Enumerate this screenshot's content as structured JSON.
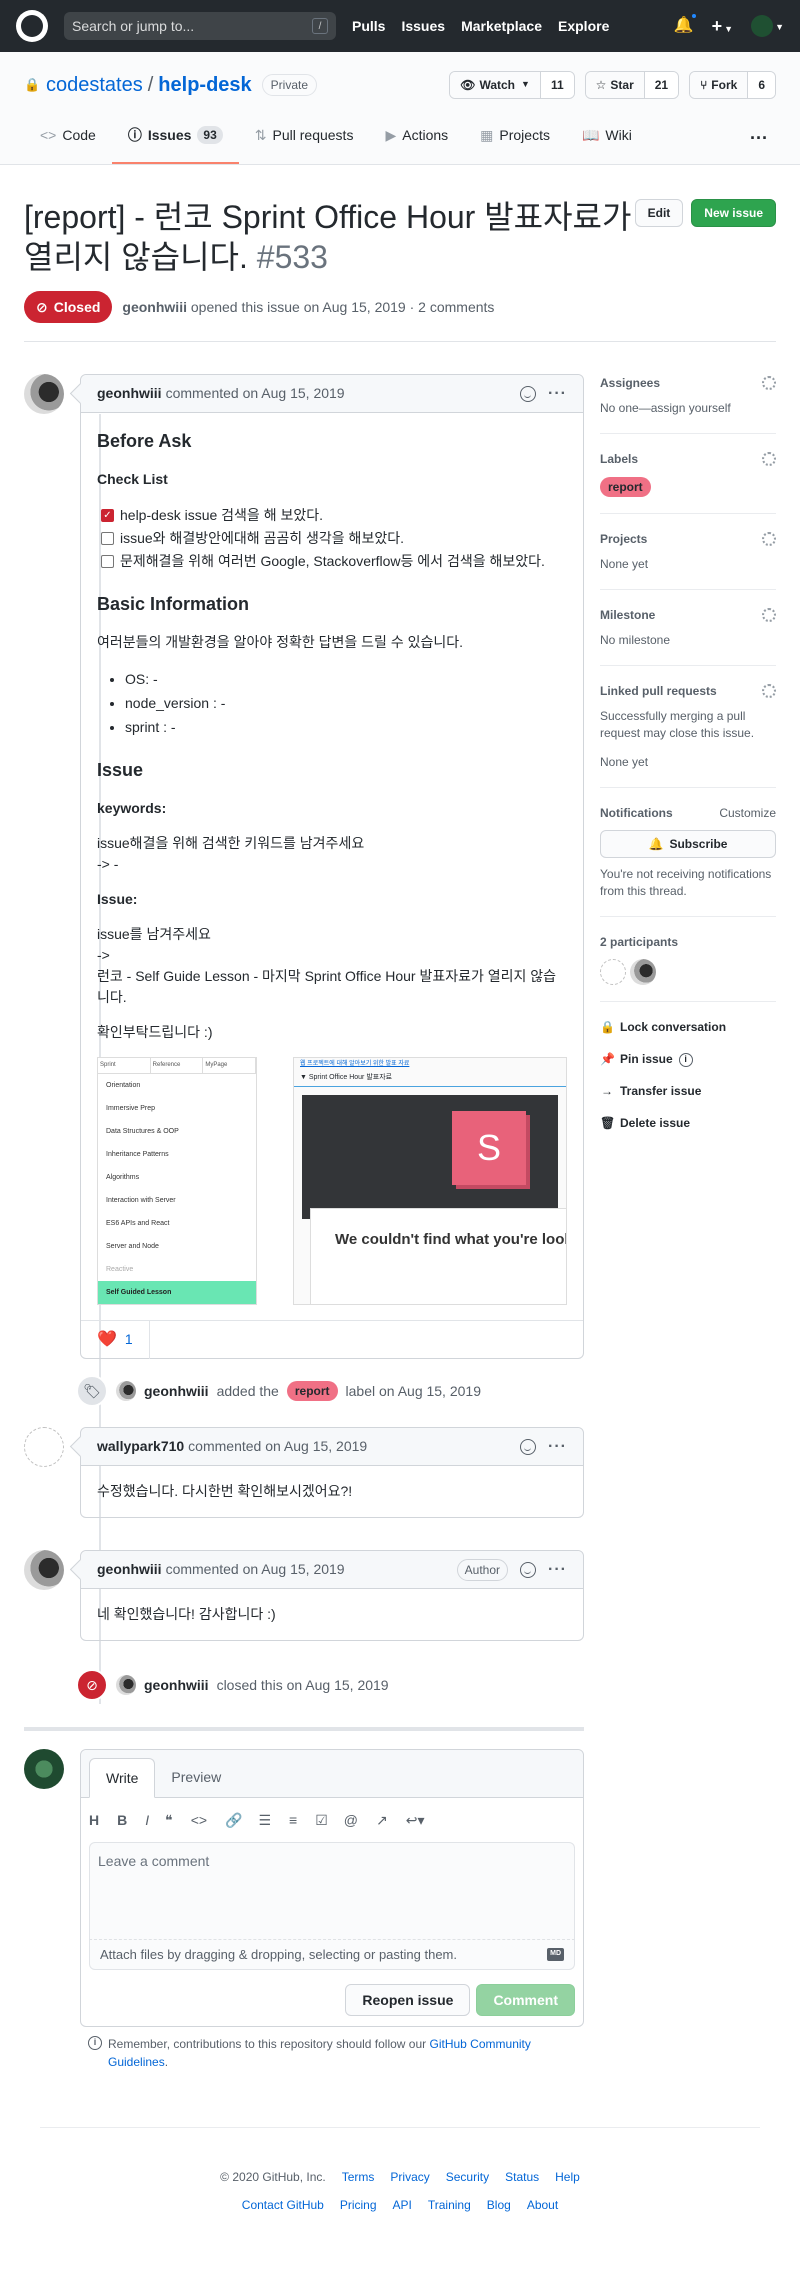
{
  "header": {
    "search_placeholder": "Search or jump to...",
    "search_hotkey": "/",
    "nav": [
      "Pulls",
      "Issues",
      "Marketplace",
      "Explore"
    ]
  },
  "repo": {
    "owner": "codestates",
    "separator": "/",
    "name": "help-desk",
    "visibility": "Private",
    "watch_label": "Watch",
    "watch_count": "11",
    "star_label": "Star",
    "star_count": "21",
    "fork_label": "Fork",
    "fork_count": "6",
    "tabs": [
      {
        "label": "Code",
        "icon": "code-icon"
      },
      {
        "label": "Issues",
        "icon": "issue-icon",
        "count": "93"
      },
      {
        "label": "Pull requests",
        "icon": "pull-request-icon"
      },
      {
        "label": "Actions",
        "icon": "play-icon"
      },
      {
        "label": "Projects",
        "icon": "project-icon"
      },
      {
        "label": "Wiki",
        "icon": "book-icon"
      }
    ]
  },
  "issue": {
    "title": "[report] - 런코 Sprint Office Hour 발표자료가 열리지 않습니다.",
    "number": "#533",
    "edit_label": "Edit",
    "new_issue_label": "New issue",
    "state": "Closed",
    "author": "geonhwiii",
    "meta_text": "opened this issue on Aug 15, 2019 · 2 comments"
  },
  "first_comment": {
    "author": "geonhwiii",
    "meta": "commented on Aug 15, 2019",
    "h_before_ask": "Before Ask",
    "h_check_list": "Check List",
    "checklist": [
      {
        "text": "help-desk issue 검색을 해 보았다.",
        "checked": true
      },
      {
        "text": "issue와 해결방안에대해 곰곰히 생각을 해보았다.",
        "checked": false
      },
      {
        "text": "문제해결을 위해 여러번 Google, Stackoverflow등 에서 검색을 해보았다.",
        "checked": false
      }
    ],
    "h_basic_info": "Basic Information",
    "basic_info_text": "여러분들의 개발환경을 알아야 정확한 답변을 드릴 수 있습니다.",
    "env": [
      "OS: -",
      "node_version : -",
      "sprint : -"
    ],
    "h_issue": "Issue",
    "h_keywords": "keywords:",
    "keywords_line1": "issue해결을 위해 검색한 키워드를 남겨주세요",
    "keywords_line2": "-> -",
    "h_issue_sub": "Issue:",
    "issue_line1": "issue를 남겨주세요",
    "issue_line2": "->",
    "issue_line3": "런코 - Self Guide Lesson - 마지막 Sprint Office Hour 발표자료가 열리지 않습니다.",
    "closing": "확인부탁드립니다 :)",
    "screenshot": {
      "tabs": [
        "Sprint",
        "Reference",
        "MyPage"
      ],
      "menu": [
        "Orientation",
        "Immersive Prep",
        "Data Structures & OOP",
        "Inheritance Patterns",
        "Algorithms",
        "Interaction with Server",
        "ES6 APIs and React",
        "Server and Node",
        "Reactive",
        "Self Guided Lesson"
      ],
      "top_link": "웹 프로젝트에 대해 알아보기 위한 발표 자료",
      "bar_text": "▼ Sprint Office Hour 발표자료",
      "logo_letter": "S",
      "error_text": "We couldn't find what you're look"
    },
    "reaction_count": "1"
  },
  "label_event": {
    "actor": "geonhwiii",
    "text_before": "added the",
    "label": "report",
    "text_after": "label on Aug 15, 2019"
  },
  "comment2": {
    "author": "wallypark710",
    "meta": "commented on Aug 15, 2019",
    "body": "수정했습니다. 다시한번 확인해보시겠어요?!"
  },
  "comment3": {
    "author": "geonhwiii",
    "meta": "commented on Aug 15, 2019",
    "badge": "Author",
    "body": "네 확인했습니다! 감사합니다 :)"
  },
  "close_event": {
    "actor": "geonhwiii",
    "text": "closed this on Aug 15, 2019"
  },
  "new_comment": {
    "tab_write": "Write",
    "tab_preview": "Preview",
    "placeholder": "Leave a comment",
    "attach_text": "Attach files by dragging & dropping, selecting or pasting them.",
    "md_badge": "MD",
    "reopen_label": "Reopen issue",
    "comment_label": "Comment",
    "guidelines_prefix": "Remember, contributions to this repository should follow our",
    "guidelines_link": "GitHub Community Guidelines",
    "guidelines_suffix": "."
  },
  "sidebar": {
    "assignees_title": "Assignees",
    "assignees_text": "No one—assign yourself",
    "labels_title": "Labels",
    "label": "report",
    "projects_title": "Projects",
    "projects_text": "None yet",
    "milestone_title": "Milestone",
    "milestone_text": "No milestone",
    "linked_title": "Linked pull requests",
    "linked_text": "Successfully merging a pull request may close this issue.",
    "linked_none": "None yet",
    "notifications_title": "Notifications",
    "customize": "Customize",
    "subscribe": "Subscribe",
    "notifications_text": "You're not receiving notifications from this thread.",
    "participants_title": "2 participants",
    "lock": "Lock conversation",
    "pin": "Pin issue",
    "transfer": "Transfer issue",
    "delete": "Delete issue"
  },
  "footer": {
    "copyright": "© 2020 GitHub, Inc.",
    "row1": [
      "Terms",
      "Privacy",
      "Security",
      "Status",
      "Help"
    ],
    "row2": [
      "Contact GitHub",
      "Pricing",
      "API",
      "Training",
      "Blog",
      "About"
    ]
  },
  "colors": {
    "closed": "#cb2431",
    "label_report": "#f07085",
    "green": "#2ea44f",
    "tab_underline": "#f9826c"
  }
}
